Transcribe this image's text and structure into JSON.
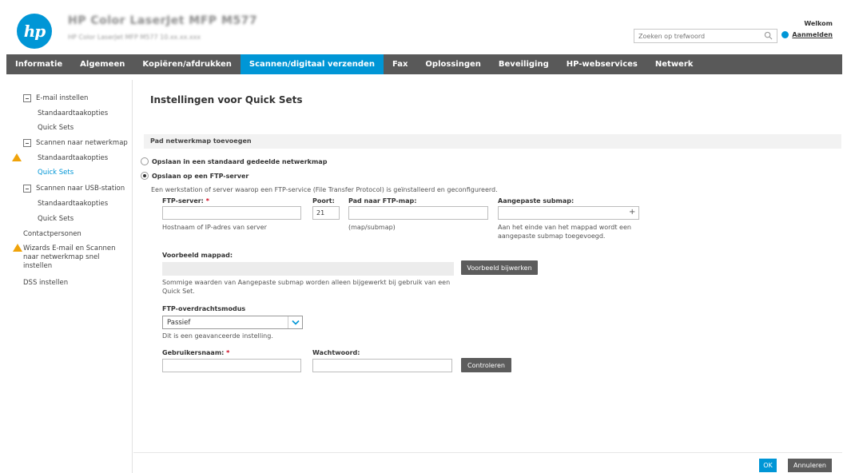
{
  "header": {
    "logo_text": "hp",
    "product_title": "HP Color LaserJet MFP M577",
    "product_subtitle": "HP Color LaserJet MFP M577   10.xx.xx.xxx",
    "search": {
      "placeholder": "Zoeken op trefwoord",
      "value": ""
    },
    "welcome": "Welkom",
    "login": "Aanmelden"
  },
  "nav": {
    "tabs": [
      {
        "label": "Informatie",
        "active": false
      },
      {
        "label": "Algemeen",
        "active": false
      },
      {
        "label": "Kopiëren/afdrukken",
        "active": false
      },
      {
        "label": "Scannen/digitaal verzenden",
        "active": true
      },
      {
        "label": "Fax",
        "active": false
      },
      {
        "label": "Oplossingen",
        "active": false
      },
      {
        "label": "Beveiliging",
        "active": false
      },
      {
        "label": "HP-webservices",
        "active": false
      },
      {
        "label": "Netwerk",
        "active": false
      }
    ]
  },
  "sidebar": {
    "email_setup": "E-mail instellen",
    "email_default": "Standaardtaakopties",
    "email_quicksets": "Quick Sets",
    "network_folder": "Scannen naar netwerkmap",
    "network_default": "Standaardtaakopties",
    "network_quicksets": "Quick Sets",
    "usb": "Scannen naar USB-station",
    "usb_default": "Standaardtaakopties",
    "usb_quicksets": "Quick Sets",
    "contacts": "Contactpersonen",
    "wizard_line1": "Wizards E-mail en Scannen",
    "wizard_line2": "naar netwerkmap snel",
    "wizard_line3": "instellen",
    "dss": "DSS instellen"
  },
  "main": {
    "page_title": "Instellingen voor Quick Sets",
    "section_title": "Pad netwerkmap toevoegen",
    "radio_standard": "Opslaan in een standaard gedeelde netwerkmap",
    "radio_ftp": "Opslaan op een FTP-server",
    "ftp_description": "Een werkstation of server waarop een FTP-service (File Transfer Protocol) is geïnstalleerd en geconfigureerd.",
    "ftp_server_label": "FTP-server:",
    "required_mark": "*",
    "ftp_server_value": "",
    "ftp_server_hint": "Hostnaam of IP-adres van server",
    "port_label": "Poort:",
    "port_value": "21",
    "path_label": "Pad naar FTP-map:",
    "path_value": "",
    "path_hint": "(map/submap)",
    "custom_subfolder_label": "Aangepaste submap:",
    "custom_subfolder_value": "",
    "plus": "+",
    "custom_hint_line1": "Aan het einde van het mappad wordt een",
    "custom_hint_line2": "aangepaste submap toegevoegd.",
    "preview_label": "Voorbeeld mappad:",
    "update_preview_button": "Voorbeeld bijwerken",
    "preview_note_line1": "Sommige waarden van Aangepaste submap worden alleen bijgewerkt bij gebruik van een",
    "preview_note_line2": "Quick Set.",
    "transfer_mode_label": "FTP-overdrachtsmodus",
    "transfer_mode_value": "Passief",
    "advanced_note": "Dit is een geavanceerde instelling.",
    "username_label": "Gebruikersnaam:",
    "username_value": "",
    "password_label": "Wachtwoord:",
    "password_value": "",
    "verify_button": "Controleren"
  },
  "footer": {
    "ok": "OK",
    "cancel": "Annuleren"
  },
  "colors": {
    "accent": "#0096d6",
    "nav_bg": "#595959",
    "warning": "#f0a30a",
    "required": "#d0021b"
  }
}
